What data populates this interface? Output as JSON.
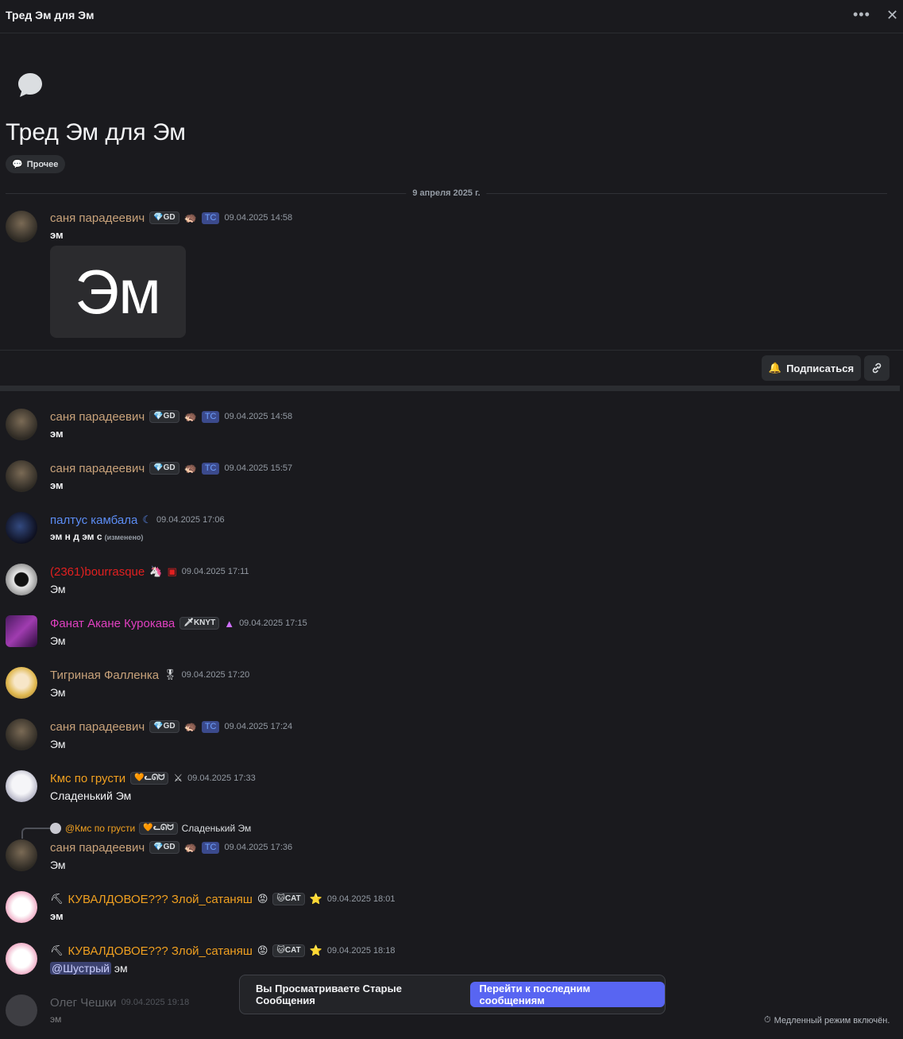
{
  "topbar": {
    "title": "Тред Эм для Эм",
    "more_icon": "more-dots-icon",
    "close_icon": "close-icon"
  },
  "thread": {
    "title": "Тред Эм для Эм",
    "tag": "Прочее",
    "tag_icon": "speech-bubble-icon"
  },
  "date_separator": "9 апреля 2025 г.",
  "starter": {
    "user": "саня парадеевич",
    "badge": "GD",
    "tc": "TC",
    "time": "09.04.2025 14:58",
    "text": "эм",
    "image_text": "Эм"
  },
  "actions": {
    "subscribe": "Подписаться",
    "link_icon": "link-icon",
    "bell_icon": "bell-icon"
  },
  "messages": [
    {
      "user": "саня парадеевич",
      "color": "#c8a27a",
      "badge": "GD",
      "tc": "TC",
      "time": "09.04.2025 14:58",
      "text": "эм"
    },
    {
      "user": "саня парадеевич",
      "color": "#c8a27a",
      "badge": "GD",
      "tc": "TC",
      "time": "09.04.2025 15:57",
      "text": "эм"
    },
    {
      "user": "палтус камбала",
      "color": "#5c8df5",
      "time": "09.04.2025 17:06",
      "text": "эм н д эм с",
      "edited": "(изменено)"
    },
    {
      "user": "(2361)bourrasque",
      "color": "#e02020",
      "time": "09.04.2025 17:11",
      "text": "Эм"
    },
    {
      "user": "Фанат Акане Курокава",
      "color": "#e040c0",
      "badge": "KNYT",
      "time": "09.04.2025 17:15",
      "text": "Эм"
    },
    {
      "user": "Тигриная Фалленка",
      "color": "#c8a27a",
      "time": "09.04.2025 17:20",
      "text": "Эм"
    },
    {
      "user": "саня парадеевич",
      "color": "#c8a27a",
      "badge": "GD",
      "tc": "TC",
      "time": "09.04.2025 17:24",
      "text": "Эм"
    },
    {
      "user": "Кмс по грусти",
      "color": "#f0a020",
      "badge": "ᓚᘏᗢ",
      "time": "09.04.2025 17:33",
      "text": "Сладенький Эм"
    },
    {
      "user": "саня парадеевич",
      "color": "#c8a27a",
      "badge": "GD",
      "tc": "TC",
      "time": "09.04.2025 17:36",
      "text": "Эм",
      "reply": {
        "user": "@Кмс по грусти",
        "badge": "ᓚᘏᗢ",
        "text": "Сладенький Эм"
      }
    },
    {
      "user": "КУВАЛДОВОЕ??? Злой_сатаняш",
      "color": "#f0a020",
      "badge": "CAT",
      "time": "09.04.2025 18:01",
      "text": "эм"
    },
    {
      "user": "КУВАЛДОВОЕ??? Злой_сатаняш",
      "color": "#f0a020",
      "badge": "CAT",
      "time": "09.04.2025 18:18",
      "mention": "@Шустрый",
      "text": "эм"
    },
    {
      "user": "Олег Чешки",
      "color": "#b5bac1",
      "time": "09.04.2025 19:18",
      "text": "эм"
    }
  ],
  "jump_bar": {
    "text": "Вы Просматриваете Старые Сообщения",
    "button": "Перейти к последним сообщениям"
  },
  "slowmode": "Медленный режим включён."
}
